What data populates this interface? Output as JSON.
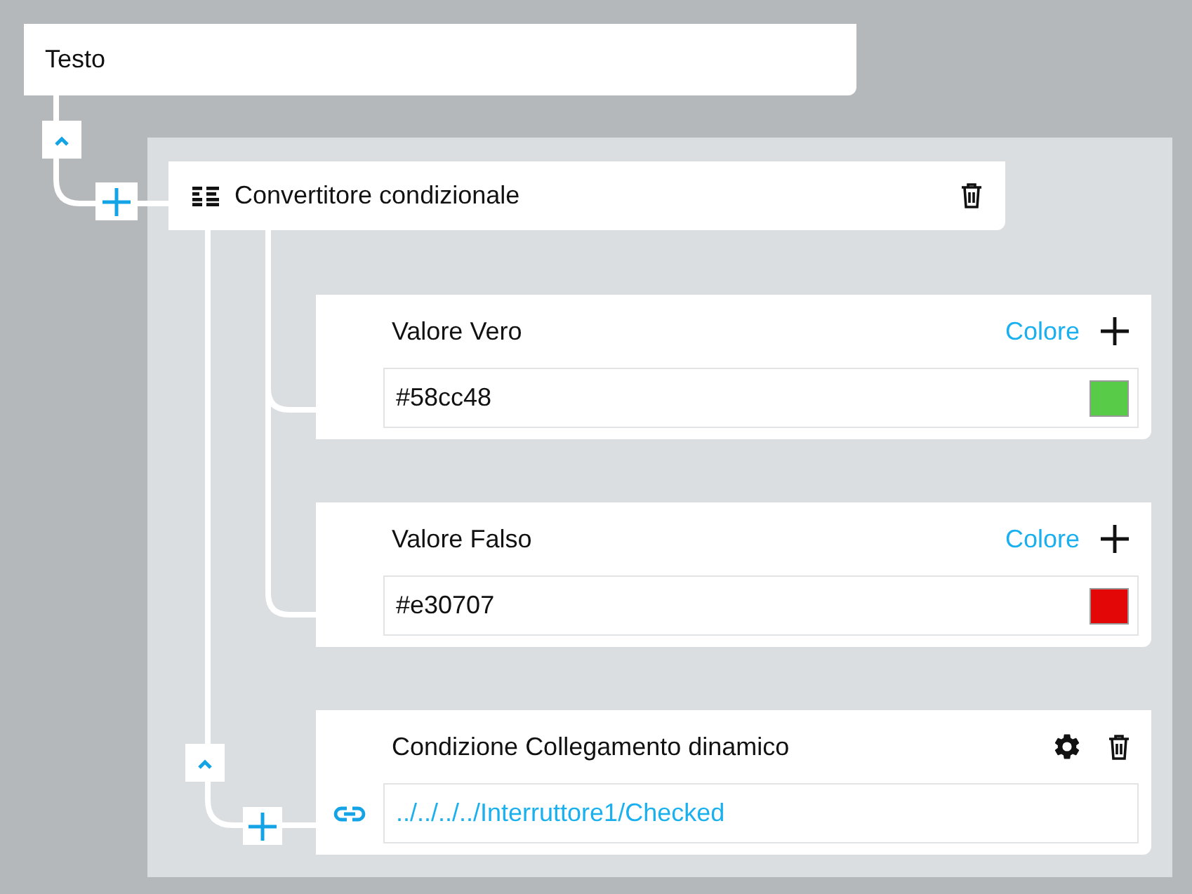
{
  "root": {
    "title": "Testo"
  },
  "converter": {
    "title": "Convertitore condizionale",
    "properties": [
      {
        "kind": "color",
        "label": "Valore Vero",
        "action": "Colore",
        "value": "#58cc48",
        "color": "#58cc48"
      },
      {
        "kind": "color",
        "label": "Valore Falso",
        "action": "Colore",
        "value": "#e30707",
        "color": "#e30707"
      },
      {
        "kind": "binding",
        "label": "Condizione Collegamento dinamico",
        "value": "../../../../Interruttore1/Checked"
      }
    ]
  }
}
